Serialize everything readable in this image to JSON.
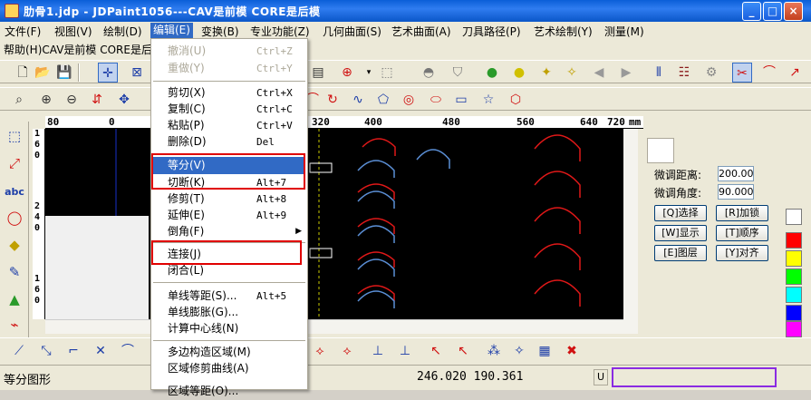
{
  "window": {
    "title": "肋骨1.jdp - JDPaint1056---CAV是前模 CORE是后模",
    "minimize_label": "_",
    "maximize_label": "□",
    "close_label": "×"
  },
  "menubar": {
    "items": [
      {
        "label": "文件(F)"
      },
      {
        "label": "视图(V)"
      },
      {
        "label": "绘制(D)"
      },
      {
        "label": "编辑(E)"
      },
      {
        "label": "变换(B)"
      },
      {
        "label": "专业功能(Z)"
      },
      {
        "label": "几何曲面(S)"
      },
      {
        "label": "艺术曲面(A)"
      },
      {
        "label": "刀具路径(P)"
      },
      {
        "label": "艺术绘制(Y)"
      },
      {
        "label": "测量(M)"
      }
    ],
    "second_row": "帮助(H)CAV是前模 CORE是后模"
  },
  "edit_menu": {
    "items": [
      {
        "label": "撤消(U)",
        "shortcut": "Ctrl+Z",
        "state": "disabled"
      },
      {
        "label": "重做(Y)",
        "shortcut": "Ctrl+Y",
        "state": "disabled"
      },
      {
        "label": "剪切(X)",
        "shortcut": "Ctrl+X",
        "state": "normal"
      },
      {
        "label": "复制(C)",
        "shortcut": "Ctrl+C",
        "state": "normal"
      },
      {
        "label": "粘贴(P)",
        "shortcut": "Ctrl+V",
        "state": "normal"
      },
      {
        "label": "删除(D)",
        "shortcut": "Del",
        "state": "normal"
      },
      {
        "label": "等分(V)",
        "shortcut": "",
        "state": "highlighted"
      },
      {
        "label": "切断(K)",
        "shortcut": "Alt+7",
        "state": "normal"
      },
      {
        "label": "修剪(T)",
        "shortcut": "Alt+8",
        "state": "normal"
      },
      {
        "label": "延伸(E)",
        "shortcut": "Alt+9",
        "state": "normal"
      },
      {
        "label": "倒角(F)",
        "shortcut": "",
        "state": "submenu"
      },
      {
        "label": "连接(J)",
        "shortcut": "",
        "state": "normal"
      },
      {
        "label": "闭合(L)",
        "shortcut": "",
        "state": "normal"
      },
      {
        "label": "单线等距(S)...",
        "shortcut": "Alt+5",
        "state": "normal"
      },
      {
        "label": "单线膨胀(G)...",
        "shortcut": "",
        "state": "normal"
      },
      {
        "label": "计算中心线(N)",
        "shortcut": "",
        "state": "normal"
      },
      {
        "label": "多边构造区域(M)",
        "shortcut": "",
        "state": "normal"
      },
      {
        "label": "区域修剪曲线(A)",
        "shortcut": "",
        "state": "normal"
      },
      {
        "label": "区域等距(O)...",
        "shortcut": "",
        "state": "normal"
      }
    ]
  },
  "ruler": {
    "ticks": [
      "80",
      "0",
      "320",
      "400",
      "480",
      "560",
      "640",
      "720",
      "mm"
    ],
    "v_ticks": [
      "1",
      "6",
      "0",
      "2",
      "4",
      "0",
      "1",
      "6",
      "0"
    ]
  },
  "right_panel": {
    "fine_distance_label": "微调距离:",
    "fine_distance_value": "200.00",
    "fine_angle_label": "微调角度:",
    "fine_angle_value": "90.000",
    "buttons": [
      "[Q]选择",
      "[R]加锁",
      "[W]显示",
      "[T]顺序",
      "[E]图层",
      "[Y]对齐"
    ]
  },
  "status": {
    "message": "等分图形",
    "coords": "246.020 190.361",
    "mode": "U"
  },
  "colors": {
    "accent": "#316ac5",
    "highlight_box": "#e00000",
    "status_box": "#8a2be2",
    "drawing_red": "#e01818",
    "drawing_blue": "#5b8fd6"
  },
  "palette": [
    "#ffffff",
    "#ff0000",
    "#ffff00",
    "#00ff00",
    "#00ffff",
    "#0000ff",
    "#ff00ff"
  ]
}
